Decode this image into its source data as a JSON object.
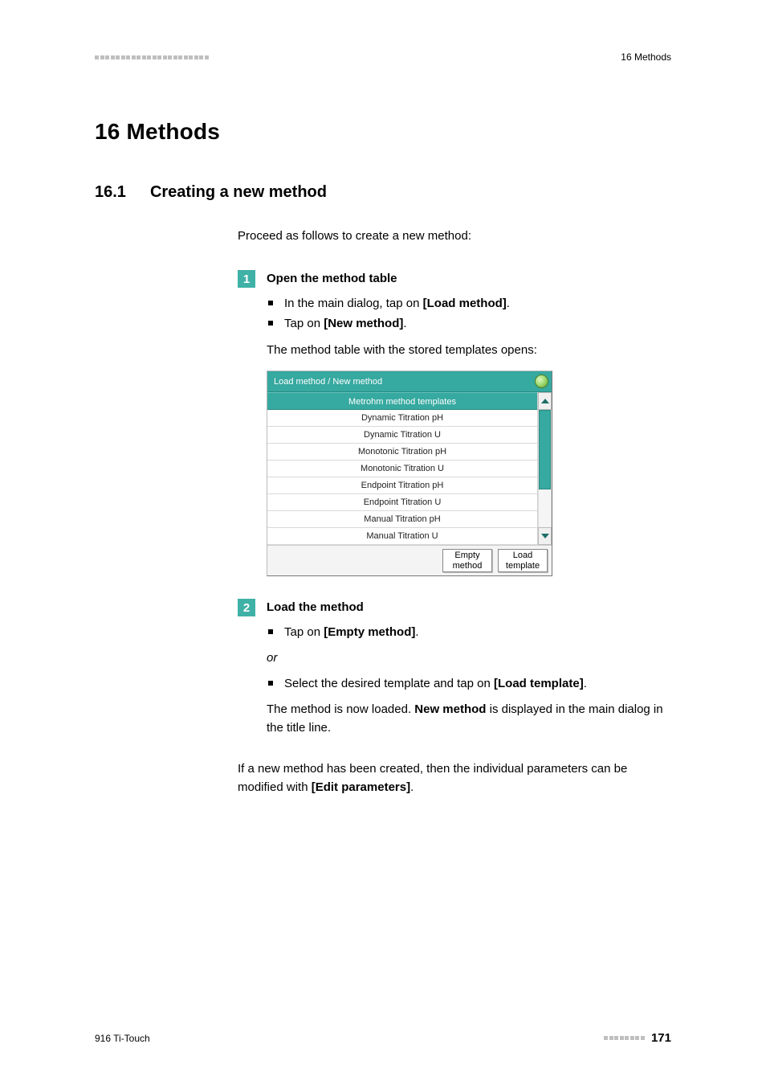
{
  "header": {
    "right": "16 Methods"
  },
  "h1": "16 Methods",
  "h2": {
    "num": "16.1",
    "title": "Creating a new method"
  },
  "intro": "Proceed as follows to create a new method:",
  "step1": {
    "num": "1",
    "title": "Open the method table",
    "bullet1_pre": "In the main dialog, tap on ",
    "bullet1_bold": "[Load method]",
    "bullet1_post": ".",
    "bullet2_pre": "Tap on ",
    "bullet2_bold": "[New method]",
    "bullet2_post": ".",
    "after": "The method table with the stored templates opens:"
  },
  "ui": {
    "title": "Load method / New method",
    "list_header": "Metrohm method templates",
    "rows": [
      "Dynamic Titration pH",
      "Dynamic Titration U",
      "Monotonic Titration pH",
      "Monotonic Titration U",
      "Endpoint Titration pH",
      "Endpoint Titration U",
      "Manual Titration pH",
      "Manual Titration U"
    ],
    "btn_left": "Empty\nmethod",
    "btn_right": "Load\ntemplate"
  },
  "step2": {
    "num": "2",
    "title": "Load the method",
    "bullet1_pre": "Tap on ",
    "bullet1_bold": "[Empty method]",
    "bullet1_post": ".",
    "or": "or",
    "bullet2_pre": "Select the desired template and tap on ",
    "bullet2_bold": "[Load template]",
    "bullet2_post": ".",
    "after_pre": "The method is now loaded. ",
    "after_bold": "New method",
    "after_post": " is displayed in the main dialog in the title line."
  },
  "closing_pre": "If a new method has been created, then the individual parameters can be modified with ",
  "closing_bold": "[Edit parameters]",
  "closing_post": ".",
  "footer": {
    "left": "916 Ti-Touch",
    "page": "171"
  }
}
